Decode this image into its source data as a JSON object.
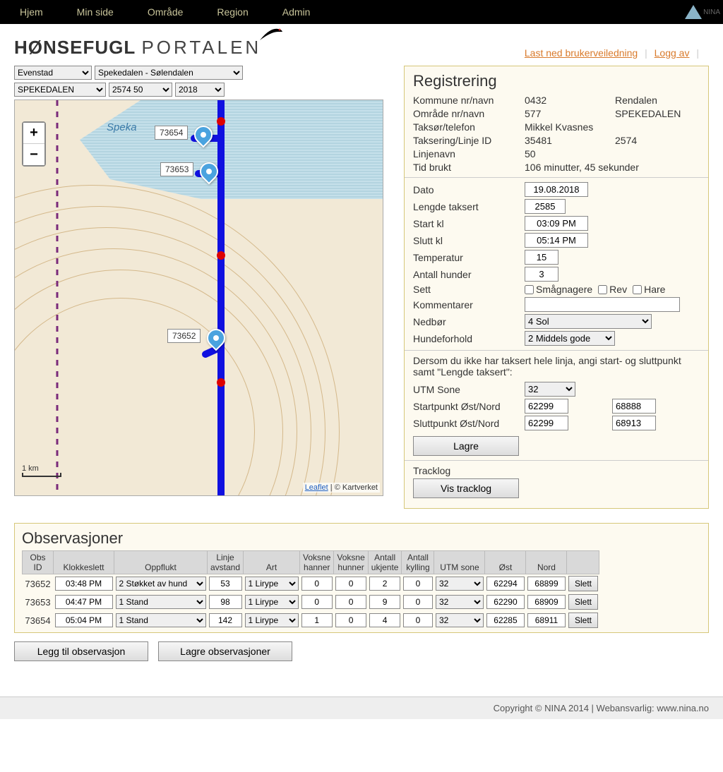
{
  "nav": {
    "hjem": "Hjem",
    "minside": "Min side",
    "omrade": "Område",
    "region": "Region",
    "admin": "Admin",
    "nina": "NINA"
  },
  "logo": {
    "bold": "HØNSEFUGL",
    "thin": "PORTALEN"
  },
  "header_links": {
    "download": "Last ned brukerveiledning",
    "logout": "Logg av"
  },
  "selectors": {
    "s1": "Evenstad",
    "s2": "Spekedalen - Sølendalen",
    "s3": "SPEKEDALEN",
    "s4": "2574 50",
    "s5": "2018"
  },
  "map": {
    "river_label": "Speka",
    "zoom_in": "+",
    "zoom_out": "−",
    "scale": "1 km",
    "attr_leaflet": "Leaflet",
    "attr_sep": " | © ",
    "attr_kart": "Kartverket",
    "markers": {
      "m1": "73654",
      "m2": "73653",
      "m3": "73652"
    }
  },
  "reg": {
    "title": "Registrering",
    "rows": {
      "kommune_l": "Kommune nr/navn",
      "kommune_v1": "0432",
      "kommune_v2": "Rendalen",
      "omrade_l": "Område nr/navn",
      "omrade_v1": "577",
      "omrade_v2": "SPEKEDALEN",
      "taksor_l": "Taksør/telefon",
      "taksor_v1": "Mikkel Kvasnes",
      "linjeid_l": "Taksering/Linje ID",
      "linjeid_v1": "35481",
      "linjeid_v2": "2574",
      "linjenavn_l": "Linjenavn",
      "linjenavn_v1": "50",
      "tid_l": "Tid brukt",
      "tid_v1": "106 minutter, 45 sekunder"
    },
    "form": {
      "dato_l": "Dato",
      "dato_v": "19.08.2018",
      "lengde_l": "Lengde taksert",
      "lengde_v": "2585",
      "start_l": "Start kl",
      "start_v": "03:09 PM",
      "slutt_l": "Slutt kl",
      "slutt_v": "05:14 PM",
      "temp_l": "Temperatur",
      "temp_v": "15",
      "hunder_l": "Antall hunder",
      "hunder_v": "3",
      "sett_l": "Sett",
      "sett_o1": "Smågnagere",
      "sett_o2": "Rev",
      "sett_o3": "Hare",
      "komm_l": "Kommentarer",
      "komm_v": "",
      "nedbor_l": "Nedbør",
      "nedbor_v": "4 Sol",
      "hunde_l": "Hundeforhold",
      "hunde_v": "2 Middels gode",
      "note": "Dersom du ikke har taksert hele linja, angi start- og sluttpunkt samt \"Lengde taksert\":",
      "utm_l": "UTM Sone",
      "utm_v": "32",
      "startp_l": "Startpunkt Øst/Nord",
      "startp_e": "62299",
      "startp_n": "68888",
      "sluttp_l": "Sluttpunkt Øst/Nord",
      "sluttp_e": "62299",
      "sluttp_n": "68913",
      "lagre": "Lagre",
      "tracklog_l": "Tracklog",
      "tracklog_btn": "Vis tracklog"
    }
  },
  "obs": {
    "title": "Observasjoner",
    "headers": {
      "id": "Obs ID",
      "time": "Klokkeslett",
      "opp": "Oppflukt",
      "avs": "Linje avstand",
      "art": "Art",
      "vh": "Voksne hanner",
      "vhu": "Voksne hunner",
      "uk": "Antall ukjente",
      "ky": "Antall kylling",
      "utm": "UTM sone",
      "ost": "Øst",
      "nord": "Nord"
    },
    "rows": [
      {
        "id": "73652",
        "time": "03:48 PM",
        "opp": "2 Støkket av hund",
        "avs": "53",
        "art": "1 Lirype",
        "vh": "0",
        "vhu": "0",
        "uk": "2",
        "ky": "0",
        "utm": "32",
        "ost": "62294",
        "nord": "68899",
        "del": "Slett"
      },
      {
        "id": "73653",
        "time": "04:47 PM",
        "opp": "1 Stand",
        "avs": "98",
        "art": "1 Lirype",
        "vh": "0",
        "vhu": "0",
        "uk": "9",
        "ky": "0",
        "utm": "32",
        "ost": "62290",
        "nord": "68909",
        "del": "Slett"
      },
      {
        "id": "73654",
        "time": "05:04 PM",
        "opp": "1 Stand",
        "avs": "142",
        "art": "1 Lirype",
        "vh": "1",
        "vhu": "0",
        "uk": "4",
        "ky": "0",
        "utm": "32",
        "ost": "62285",
        "nord": "68911",
        "del": "Slett"
      }
    ],
    "add": "Legg til observasjon",
    "save": "Lagre observasjoner"
  },
  "footer": {
    "text": "Copyright © NINA 2014 | Webansvarlig: www.nina.no"
  }
}
